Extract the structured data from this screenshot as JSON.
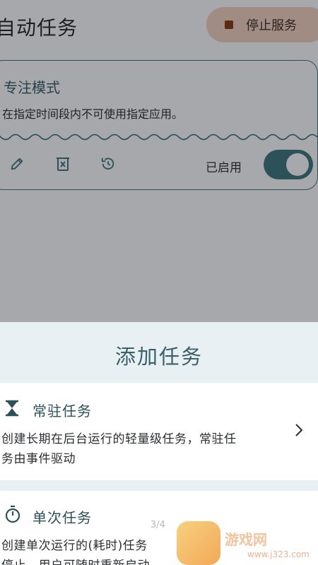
{
  "app": {
    "title": "自动任务",
    "stop_button": "停止服务"
  },
  "task_card": {
    "title": "专注模式",
    "description": "在指定时间段内不可使用指定应用。",
    "icons": [
      "edit-icon",
      "delete-icon",
      "history-icon"
    ],
    "status_label": "已启用",
    "enabled": true
  },
  "sheet": {
    "title": "添加任务",
    "options": [
      {
        "icon": "hourglass-icon",
        "title": "常驻任务",
        "description_line1": "创建长期在后台运行的轻量级任务，常驻任",
        "description_line2": "务由事件驱动"
      },
      {
        "icon": "stopwatch-icon",
        "title": "单次任务",
        "description_line1": "创建单次运行的(耗时)任务",
        "description_line2": "停止。用户可随时重新启动"
      }
    ],
    "page_indicator": "3/4"
  },
  "watermark": {
    "text": "游戏网",
    "url": "www.j323.com"
  },
  "colors": {
    "accent": "#2d5158",
    "stop_button_bg": "#a18c83",
    "sheet_bg": "#e8f0f4",
    "overlay_bg": "#a7a8ab"
  }
}
